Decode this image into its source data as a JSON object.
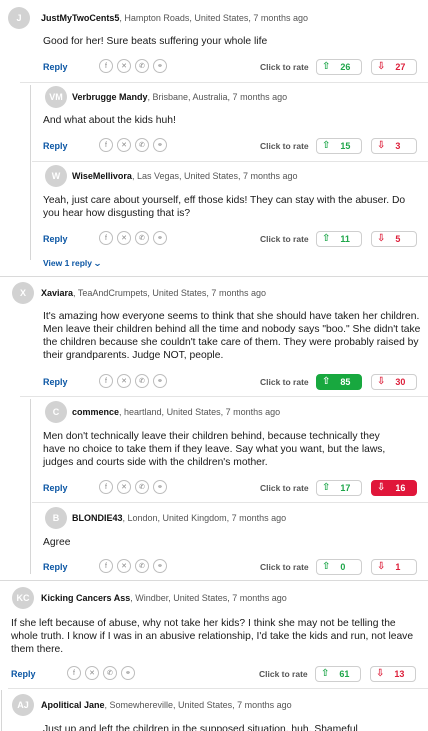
{
  "ui": {
    "reply_label": "Reply",
    "rate_label": "Click to rate"
  },
  "comments": [
    {
      "initials": "J",
      "name": "JustMyTwoCents5",
      "meta": ", Hampton Roads, United States, 7 months ago",
      "text": "Good for her! Sure beats suffering your whole life",
      "up": "26",
      "down": "27"
    },
    {
      "initials": "VM",
      "name": "Verbrugge Mandy",
      "meta": ", Brisbane, Australia, 7 months ago",
      "text": "And what about the kids huh!",
      "up": "15",
      "down": "3"
    },
    {
      "initials": "W",
      "name": "WiseMellivora",
      "meta": ", Las Vegas, United States, 7 months ago",
      "text": "Yeah, just care about yourself, eff those kids! They can stay with the abuser. Do you hear how disgusting that is?",
      "up": "11",
      "down": "5"
    },
    {
      "initials": "X",
      "name": "Xaviara",
      "meta": ", TeaAndCrumpets, United States, 7 months ago",
      "text": "It's amazing how everyone seems to think that she should have taken her children. Men leave their children behind all the time and nobody says \"boo.\" She didn't take the children because she couldn't take care of them. They were probably raised by their grandparents. Judge NOT, people.",
      "up": "85",
      "down": "30"
    },
    {
      "initials": "C",
      "name": "commence",
      "meta": ", heartland, United States, 7 months ago",
      "text": "Men don't technically leave their children behind, because technically they have no choice to take them if they leave. Say what you want, but the laws, judges and courts side with the children's mother.",
      "up": "17",
      "down": "16"
    },
    {
      "initials": "B",
      "name": "BLONDIE43",
      "meta": ", London, United Kingdom, 7 months ago",
      "text": "Agree",
      "up": "0",
      "down": "1"
    },
    {
      "initials": "KC",
      "name": "Kicking Cancers Ass",
      "meta": ", Windber, United States, 7 months ago",
      "text": "If she left because of abuse, why not take her kids? I think she may not be telling the whole truth. I know if I was in an abusive relationship, I'd take the kids and run, not leave them there.",
      "up": "61",
      "down": "13"
    },
    {
      "initials": "AJ",
      "name": "Apolitical Jane",
      "meta": ", Somewhereville, United States, 7 months ago",
      "text": "Just up and left the children in the supposed situation, huh. Shameful"
    }
  ],
  "view_replies": "View 1 reply",
  "icons": {
    "share": [
      "facebook-icon",
      "x-icon",
      "whatsapp-icon",
      "link-icon"
    ],
    "up": "arrow-up-icon",
    "down": "arrow-down-icon",
    "chevron": "chevron-down-icon"
  },
  "colors": {
    "up": "#1fa64a",
    "down": "#dd1f3a",
    "link": "#0b56a4",
    "up_active": "#18a83f",
    "down_active": "#e0163a"
  }
}
